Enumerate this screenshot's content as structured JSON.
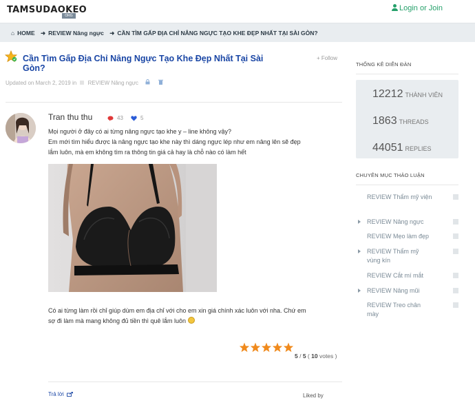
{
  "header": {
    "logo": "TAMSUDAOKEO",
    "logo_sub": "ORG",
    "login": "Login or Join"
  },
  "breadcrumb": {
    "items": [
      "HOME",
      "REVIEW Nâng ngực",
      "CẦN TÌM GẤP ĐỊA CHỈ NÂNG NGỰC TẠO KHE ĐẸP NHẤT TẠI SÀI GÒN?"
    ]
  },
  "thread": {
    "title": "Cần Tìm Gấp Địa Chỉ Nâng Ngực Tạo Khe Đẹp Nhất Tại Sài Gòn?",
    "follow": "Follow",
    "updated": "Updated on March 2, 2019 in",
    "forum": "REVIEW Nâng ngực"
  },
  "post": {
    "author": "Tran thu thu",
    "msg_count": "43",
    "like_count": "5",
    "lines": [
      "Mọi người ở đây có ai từng nâng ngực tạo khe y – line không vậy?",
      "Em mới tìm hiểu được là nâng ngực tạo khe này thì dáng ngực lép như em nâng lên sẽ đẹp",
      "lắm luôn,  mà em không tìm ra thông tin giá cả hay là chỗ nào có làm hết"
    ],
    "lines2": [
      "Có ai từng làm rồi chỉ giúp dùm em địa chỉ với cho em xin giá chính xác luôn với nha. Chứ em",
      "sợ đi làm mà mang không đủ tiền thì quê lắm luôn"
    ],
    "rating": {
      "stars": 5,
      "score": "5",
      "max": "5",
      "votes": "10",
      "votes_label": "votes"
    },
    "reply": "Trả lời",
    "liked_by": "Liked by"
  },
  "sidebar": {
    "stats_heading": "THỐNG KÊ DIỄN ĐÀN",
    "stats": [
      {
        "num": "12212",
        "label": "THÀNH VIÊN"
      },
      {
        "num": "1863",
        "label": "THREADS"
      },
      {
        "num": "44051",
        "label": "REPLIES"
      }
    ],
    "forums_heading": "CHUYÊN MỤC THẢO LUẬN",
    "forums": [
      {
        "label": "REVIEW Thẩm mỹ viện",
        "arrow": false
      },
      {
        "label": "REVIEW Nâng ngực",
        "arrow": true
      },
      {
        "label": "REVIEW Mẹo làm đẹp",
        "arrow": false
      },
      {
        "label": "REVIEW Thẩm mỹ vùng kín",
        "arrow": true
      },
      {
        "label": "REVIEW Cắt mí mắt",
        "arrow": false
      },
      {
        "label": "REVIEW Nâng mũi",
        "arrow": true
      },
      {
        "label": "REVIEW Treo chân mày",
        "arrow": false
      }
    ]
  },
  "colors": {
    "accent_green": "#25a06a",
    "link_blue": "#1a46a5",
    "star_orange": "#f08a1d"
  }
}
